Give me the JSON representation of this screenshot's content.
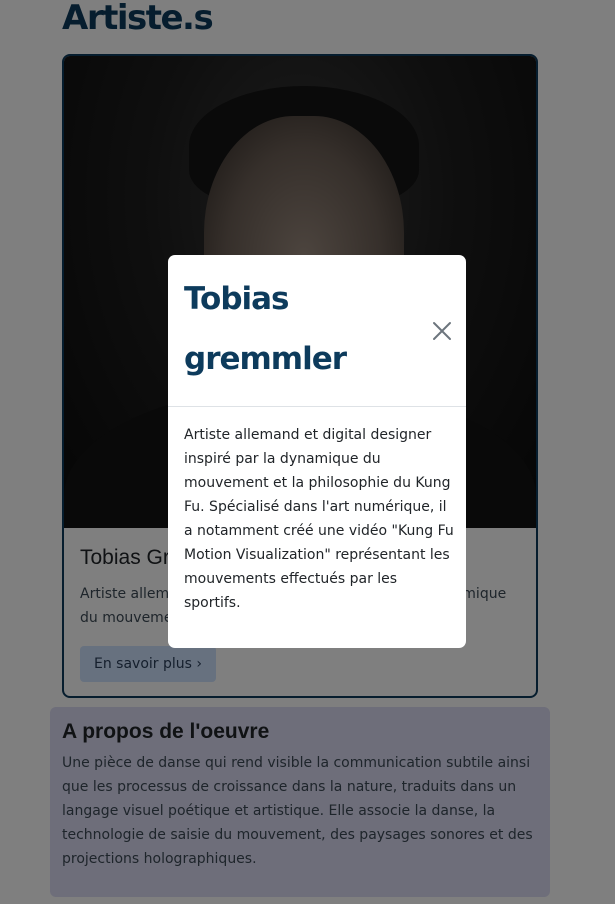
{
  "page": {
    "title": "Artiste.s"
  },
  "artist_card": {
    "name": "Tobias Gremmler",
    "description": "Artiste allemand et digital designer inspiré par la dynamique du mouvement et la philosophie du Kung Fu.",
    "more_button_label": "En savoir plus",
    "more_button_icon": "chevron-right-icon",
    "photo_alt": "Portrait de Tobias Gremmler"
  },
  "about": {
    "title": "A propos de l'oeuvre",
    "text": "Une pièce de danse qui rend visible la communication subtile ainsi que les processus de croissance dans la nature, traduits dans un langage visuel poétique et artistique. Elle associe la danse, la technologie de saisie du mouvement, des paysages sonores et des projections holographiques."
  },
  "modal": {
    "title": "Tobias gremmler",
    "close_icon": "close-icon",
    "body": "Artiste allemand et digital designer inspiré par la dynamique du mouvement et la philosophie du Kung Fu. Spécialisé dans l'art numérique, il a notamment créé une vidéo \"Kung Fu Motion Visualization\" représentant les mouvements effectués par les sportifs."
  },
  "colors": {
    "brand": "#0d3b5c",
    "button_bg": "#cfe2ff",
    "about_bg": "#dcdcf4",
    "backdrop": "rgba(0,0,0,0.5)"
  }
}
